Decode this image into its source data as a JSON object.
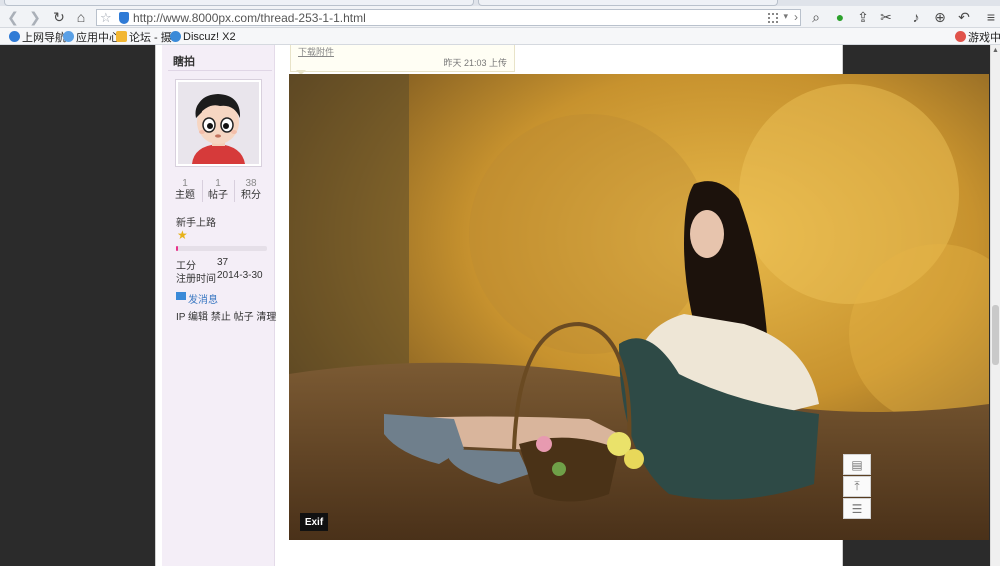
{
  "browser": {
    "url": "http://www.8000px.com/thread-253-1-1.html",
    "icons": {
      "back": "back-arrow-icon",
      "forward": "forward-arrow-icon",
      "refresh": "refresh-icon",
      "home": "home-icon",
      "favorite": "star-icon",
      "search": "search-icon",
      "chat": "wechat-icon",
      "share": "share-icon",
      "cut": "scissors-icon",
      "volume": "volume-icon",
      "download": "download-icon",
      "undo": "undo-icon",
      "menu": "menu-icon"
    }
  },
  "bookmarks": [
    {
      "label": "上网导航",
      "icon": "globe-icon"
    },
    {
      "label": "应用中心",
      "icon": "apps-icon"
    },
    {
      "label": "论坛 - 摄",
      "icon": "forum-icon"
    },
    {
      "label": "Discuz! X2",
      "icon": "discuz-icon"
    },
    {
      "label": "游戏中心",
      "icon": "game-icon"
    }
  ],
  "author": {
    "name": "瞎拍",
    "stats": [
      {
        "value": "1",
        "label": "主题"
      },
      {
        "value": "1",
        "label": "帖子"
      },
      {
        "value": "38",
        "label": "积分"
      }
    ],
    "rank": "新手上路",
    "rank_progress": 0.02,
    "work_label": "工分",
    "work_value": "37",
    "reg_label": "注册时间",
    "reg_value": "2014-3-30",
    "send_message": "发消息",
    "admin_links": "IP 编辑 禁止 帖子 清理"
  },
  "attachment": {
    "link": "下载附件",
    "meta": "昨天 21:03 上传"
  },
  "photo": {
    "exif_label": "Exif"
  },
  "float_tools": [
    {
      "icon": "comment-icon"
    },
    {
      "icon": "back-to-top-icon"
    },
    {
      "icon": "list-icon"
    }
  ]
}
